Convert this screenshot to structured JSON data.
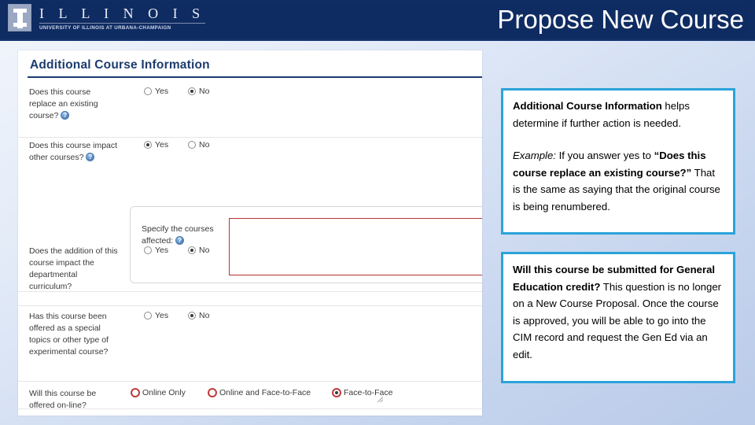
{
  "header": {
    "logo": {
      "wordmark": "I L L I N O I S",
      "tagline": "UNIVERSITY OF ILLINOIS AT URBANA-CHAMPAIGN"
    },
    "title": "Propose New Course",
    "background_color": "#0f2c62"
  },
  "form": {
    "section_title": "Additional Course Information",
    "questions": [
      {
        "label": "Does this course replace an existing course?",
        "has_help_icon": true,
        "options": [
          {
            "label": "Yes",
            "checked": false
          },
          {
            "label": "No",
            "checked": true
          }
        ]
      },
      {
        "label": "Does this course impact other courses?",
        "has_help_icon": true,
        "options": [
          {
            "label": "Yes",
            "checked": true
          },
          {
            "label": "No",
            "checked": false
          }
        ]
      },
      {
        "label": "Does the addition of this course impact the departmental curriculum?",
        "has_help_icon": false,
        "options": [
          {
            "label": "Yes",
            "checked": false
          },
          {
            "label": "No",
            "checked": true
          }
        ]
      },
      {
        "label": "Has this course been offered as a special topics or other type of experimental course?",
        "has_help_icon": false,
        "options": [
          {
            "label": "Yes",
            "checked": false
          },
          {
            "label": "No",
            "checked": true
          }
        ]
      },
      {
        "label": "Will this course be offered on-line?",
        "has_help_icon": false,
        "options": [
          {
            "label": "Online Only",
            "checked": false
          },
          {
            "label": "Online and Face-to-Face",
            "checked": false
          },
          {
            "label": "Face-to-Face",
            "checked": true
          }
        ]
      }
    ],
    "sub_panel": {
      "label": "Specify the courses affected:",
      "has_help_icon": true,
      "textarea_value": "",
      "textarea_placeholder": "",
      "required_border_color": "#b5342e"
    }
  },
  "callouts": [
    {
      "accent_color": "#2ba3da",
      "paragraph_1": {
        "bold_lead": "Additional Course Information",
        "rest": " helps determine if further action is needed."
      },
      "paragraph_2": {
        "italic_lead": "Example:",
        "mid": " If you answer yes to ",
        "bold_quote": "“Does this course replace an existing course?”",
        "tail": " That is the same as saying that the original course is being renumbered."
      }
    },
    {
      "accent_color": "#2ba3da",
      "paragraph_1": {
        "bold_lead": "Will this course be submitted for General Education credit?",
        "rest": " This question is no longer on a New Course Proposal. Once the course is approved, you will be able to go into the CIM record and request the Gen Ed via an edit."
      }
    }
  ]
}
